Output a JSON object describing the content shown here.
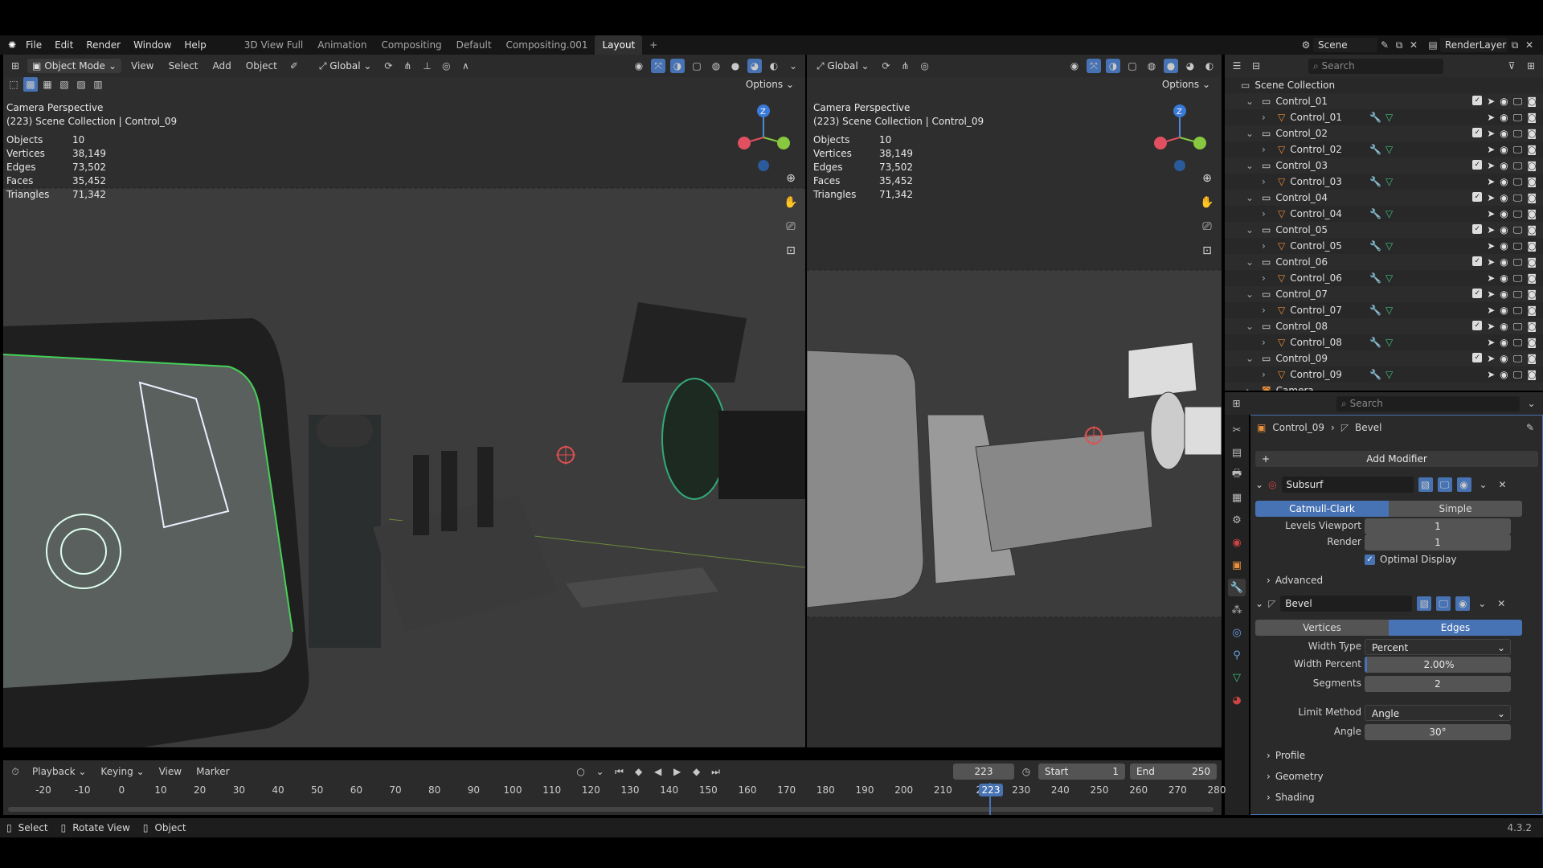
{
  "menu": {
    "items": [
      "File",
      "Edit",
      "Render",
      "Window",
      "Help"
    ],
    "workspaces": [
      "3D View Full",
      "Animation",
      "Compositing",
      "Default",
      "Compositing.001",
      "Layout"
    ],
    "active_workspace": "Layout",
    "scene": "Scene",
    "view_layer": "RenderLayer"
  },
  "viewport_left": {
    "mode": "Object Mode",
    "menus": [
      "View",
      "Select",
      "Add",
      "Object"
    ],
    "orientation": "Global",
    "options": "Options",
    "title": "Camera Perspective",
    "subtitle": "(223) Scene Collection | Control_09",
    "stats": [
      {
        "k": "Objects",
        "v": "10"
      },
      {
        "k": "Vertices",
        "v": "38,149"
      },
      {
        "k": "Edges",
        "v": "73,502"
      },
      {
        "k": "Faces",
        "v": "35,452"
      },
      {
        "k": "Triangles",
        "v": "71,342"
      }
    ]
  },
  "viewport_right": {
    "orientation": "Global",
    "options": "Options",
    "title": "Camera Perspective",
    "subtitle": "(223) Scene Collection | Control_09",
    "stats": [
      {
        "k": "Objects",
        "v": "10"
      },
      {
        "k": "Vertices",
        "v": "38,149"
      },
      {
        "k": "Edges",
        "v": "73,502"
      },
      {
        "k": "Faces",
        "v": "35,452"
      },
      {
        "k": "Triangles",
        "v": "71,342"
      }
    ]
  },
  "outliner": {
    "search_placeholder": "Search",
    "root": "Scene Collection",
    "collections": [
      "Control_01",
      "Control_02",
      "Control_03",
      "Control_04",
      "Control_05",
      "Control_06",
      "Control_07",
      "Control_08",
      "Control_09"
    ],
    "camera": "Camera"
  },
  "properties": {
    "search_placeholder": "Search",
    "breadcrumb_object": "Control_09",
    "breadcrumb_modifier": "Bevel",
    "add_modifier": "Add Modifier",
    "subsurf": {
      "name": "Subsurf",
      "catmull": "Catmull-Clark",
      "simple": "Simple",
      "levels_viewport_label": "Levels Viewport",
      "levels_viewport": "1",
      "render_label": "Render",
      "render": "1",
      "optimal_display": "Optimal Display",
      "advanced": "Advanced"
    },
    "bevel": {
      "name": "Bevel",
      "vertices": "Vertices",
      "edges": "Edges",
      "width_type_label": "Width Type",
      "width_type": "Percent",
      "width_percent_label": "Width Percent",
      "width_percent": "2.00%",
      "segments_label": "Segments",
      "segments": "2",
      "limit_method_label": "Limit Method",
      "limit_method": "Angle",
      "angle_label": "Angle",
      "angle": "30°",
      "profile": "Profile",
      "geometry": "Geometry",
      "shading": "Shading"
    }
  },
  "timeline": {
    "menus": [
      "Playback",
      "Keying",
      "View",
      "Marker"
    ],
    "current_frame": "223",
    "start_label": "Start",
    "start": "1",
    "end_label": "End",
    "end": "250",
    "ticks": [
      "-20",
      "-10",
      "0",
      "10",
      "20",
      "30",
      "40",
      "50",
      "60",
      "70",
      "80",
      "90",
      "100",
      "110",
      "120",
      "130",
      "140",
      "150",
      "160",
      "170",
      "180",
      "190",
      "200",
      "210",
      "22",
      "230",
      "240",
      "250",
      "260",
      "270",
      "280"
    ],
    "playhead_label": "223"
  },
  "status": {
    "select": "Select",
    "rotate": "Rotate View",
    "object": "Object",
    "version": "4.3.2"
  },
  "colors": {
    "accent": "#4772b3",
    "viewport_bg": "#3c3c3c",
    "panel_bg": "#2b2b2b"
  }
}
